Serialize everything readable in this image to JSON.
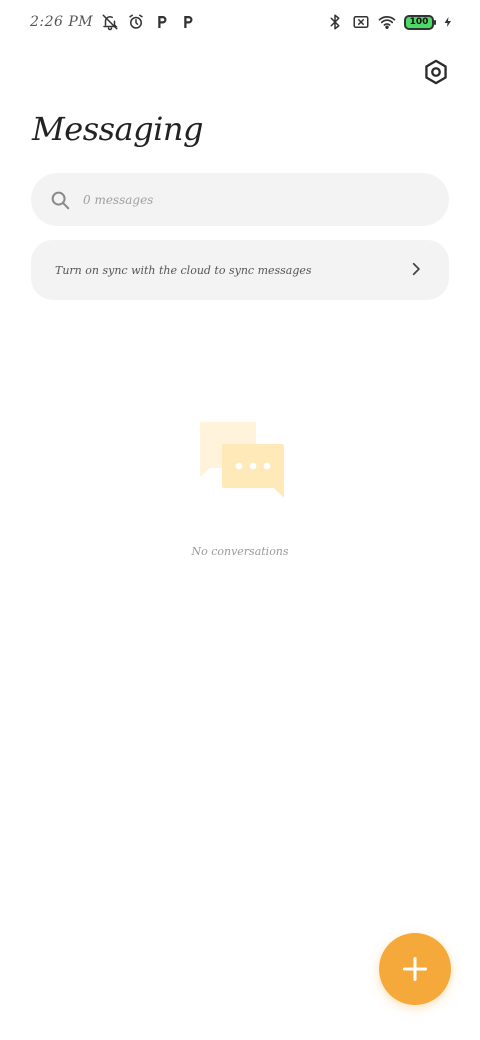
{
  "status_bar": {
    "time": "2:26 PM",
    "battery": "100",
    "left_icons": [
      "notifications-off-icon",
      "alarm-icon",
      "p-app-icon",
      "p-app-icon"
    ],
    "right_icons": [
      "bluetooth-icon",
      "no-sim-icon",
      "wifi-icon",
      "battery-icon",
      "charging-icon"
    ]
  },
  "header": {
    "title": "Messaging",
    "settings_icon": "settings-hex-icon"
  },
  "search": {
    "placeholder": "0 messages",
    "icon": "search-icon"
  },
  "sync_banner": {
    "text": "Turn on sync with the cloud to sync messages",
    "icon": "chevron-right-icon"
  },
  "empty_state": {
    "text": "No conversations",
    "icon": "chat-bubbles-icon"
  },
  "fab": {
    "icon": "plus-icon"
  },
  "colors": {
    "accent": "#f5a93a",
    "surface": "#f3f3f3",
    "illustration_light": "#fff3dc",
    "illustration_main": "#ffe9b8",
    "battery_green": "#4cd964"
  }
}
